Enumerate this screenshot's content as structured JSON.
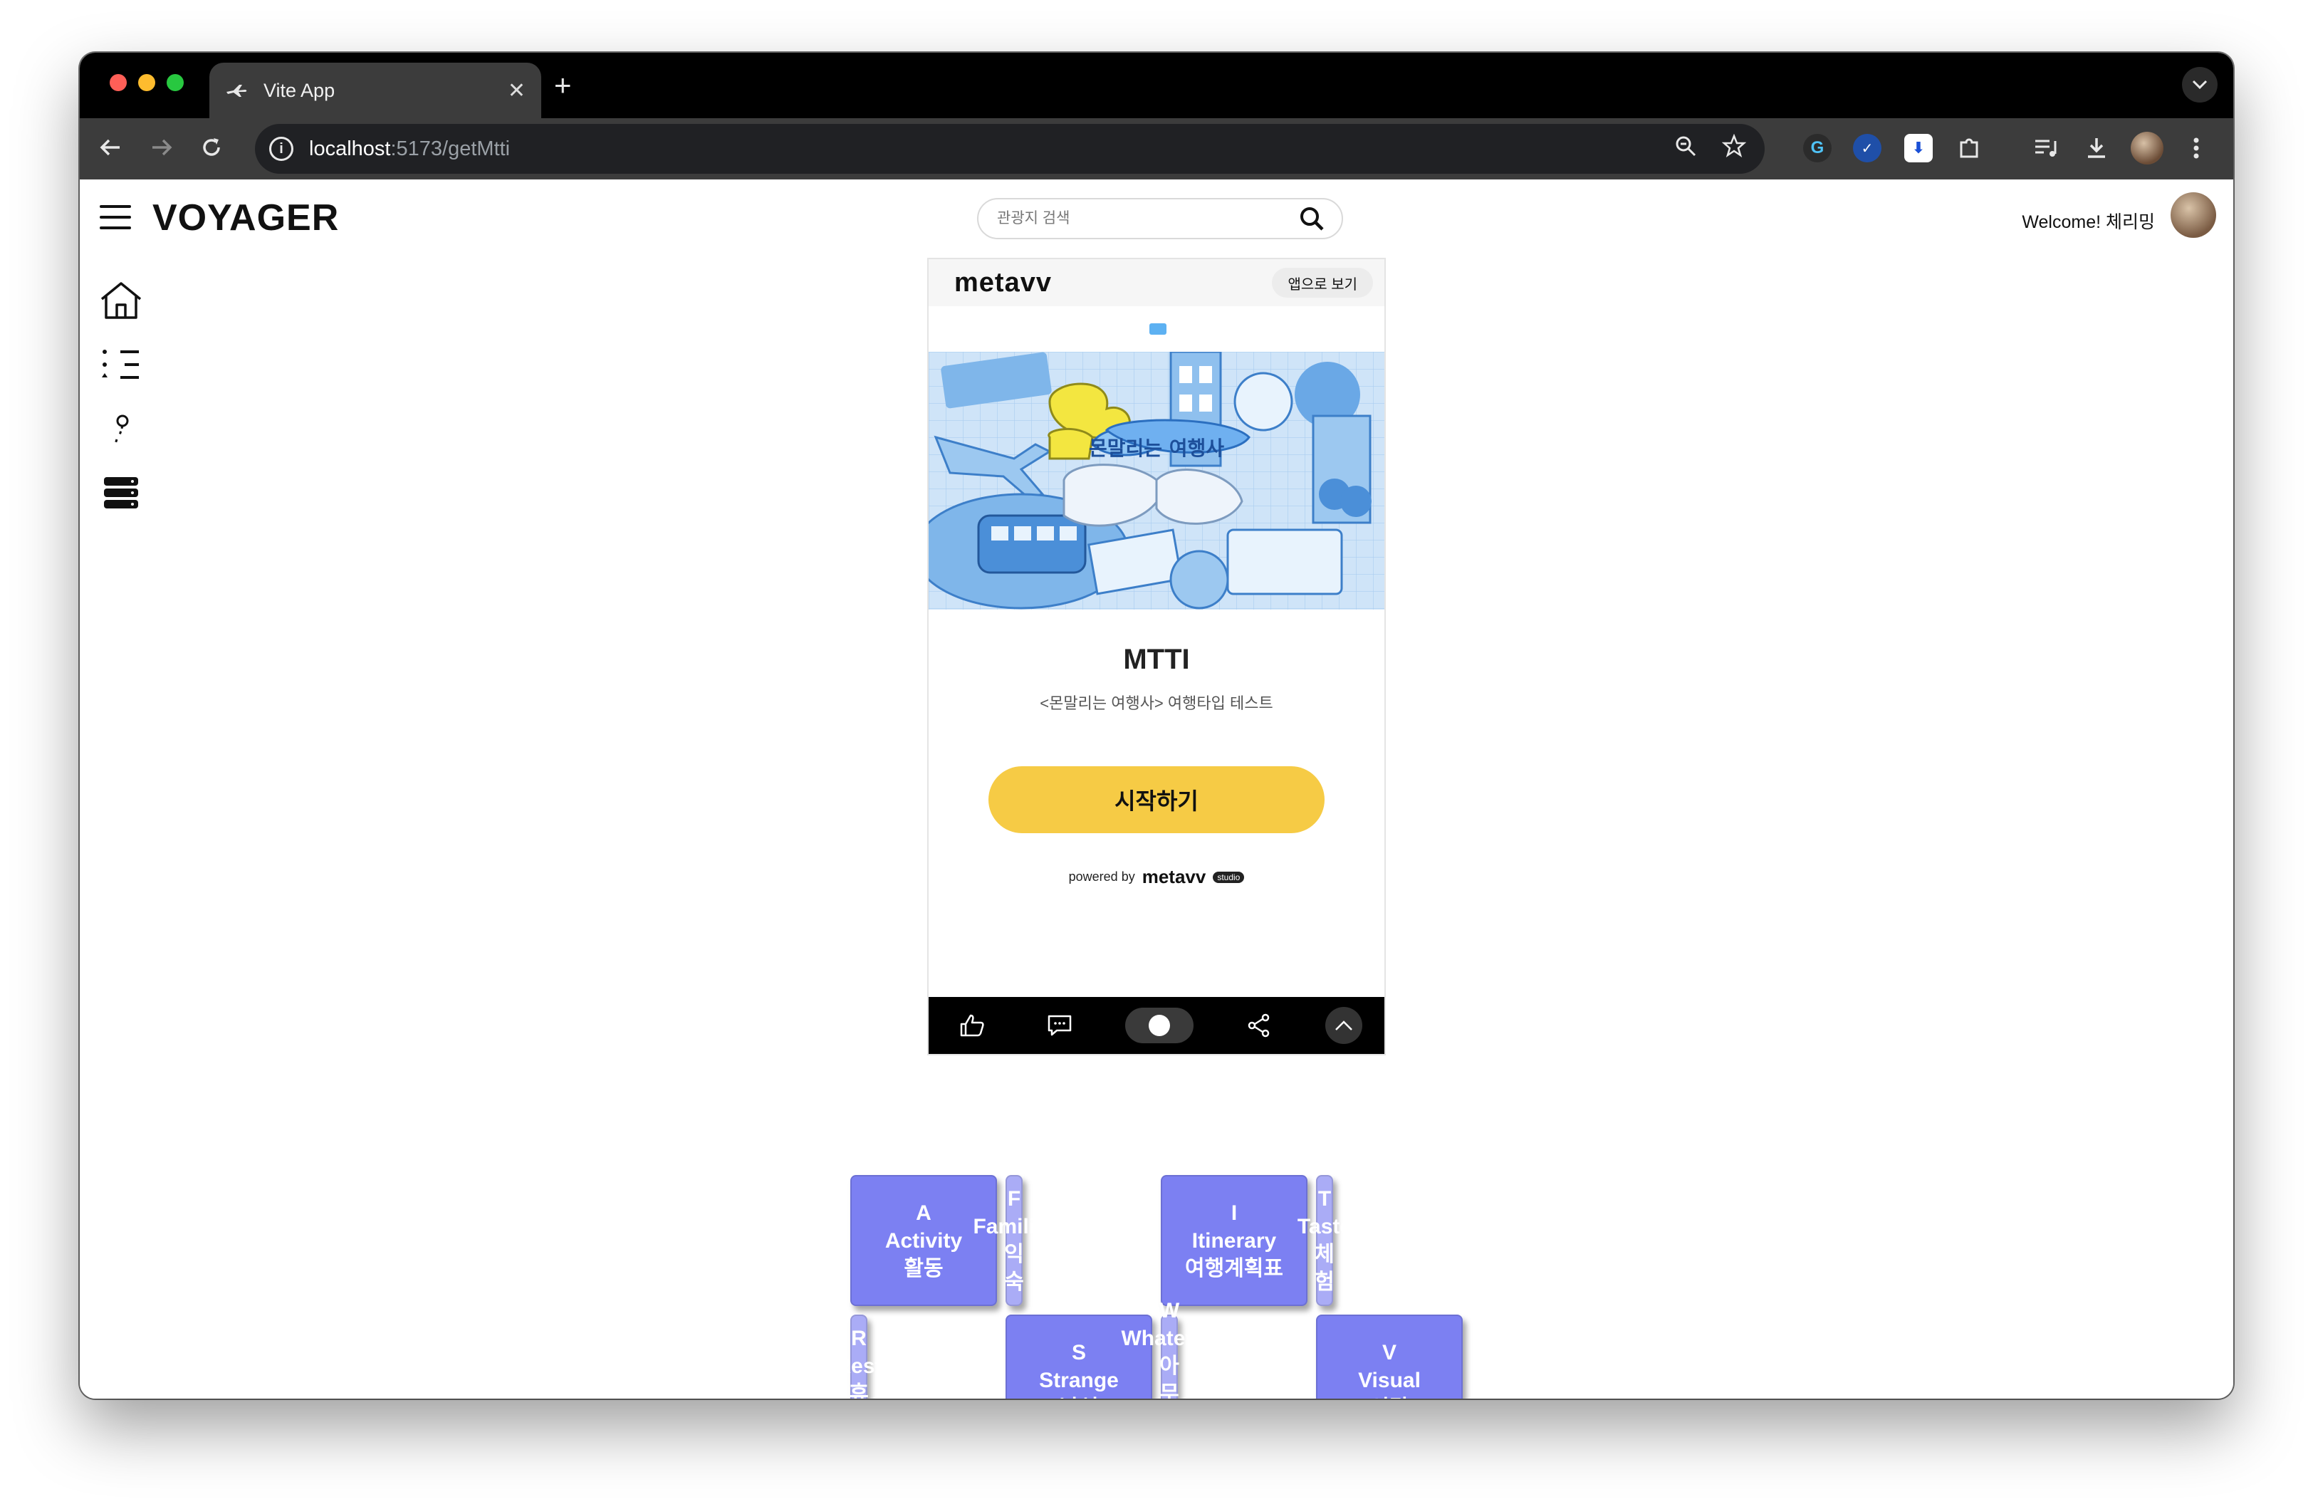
{
  "browser": {
    "tab_title": "Vite App",
    "tab_close": "✕",
    "new_tab": "+",
    "url_host": "localhost",
    "url_path": ":5173/getMtti"
  },
  "header": {
    "brand": "VOYAGER",
    "search_placeholder": "관광지 검색",
    "welcome": "Welcome! 체리밍"
  },
  "sidebar": {
    "items": [
      {
        "name": "home-icon"
      },
      {
        "name": "list-icon"
      },
      {
        "name": "pin-icon"
      },
      {
        "name": "database-icon"
      }
    ]
  },
  "embed": {
    "logo": "metavv",
    "app_button": "앱으로 보기",
    "banner_title": "몬말리는 여행사",
    "title": "MTTI",
    "subtitle": "<몬말리는 여행사> 여행타입 테스트",
    "start_button": "시작하기",
    "powered_by": "powered by",
    "powered_logo": "metavv",
    "studio": "studio"
  },
  "types": [
    {
      "letter": "A",
      "en": "Activity",
      "ko": "활동",
      "tone": "dark"
    },
    {
      "letter": "F",
      "en": "Familiar",
      "ko": "익숙",
      "tone": "light"
    },
    {
      "letter": "I",
      "en": "Itinerary",
      "ko": "여행계획표",
      "tone": "dark"
    },
    {
      "letter": "T",
      "en": "Taste",
      "ko": "체험",
      "tone": "light"
    },
    {
      "letter": "R",
      "en": "Rest",
      "ko": "휴식",
      "tone": "light"
    },
    {
      "letter": "S",
      "en": "Strange",
      "ko": "낯섬",
      "tone": "dark"
    },
    {
      "letter": "W",
      "en": "Whatever",
      "ko": "아무거나",
      "tone": "light"
    },
    {
      "letter": "V",
      "en": "Visual",
      "ko": "시각",
      "tone": "dark"
    }
  ],
  "colors": {
    "dark_card": "#7c80f2",
    "light_card": "#aaacf6",
    "start_button": "#f6cb45"
  }
}
